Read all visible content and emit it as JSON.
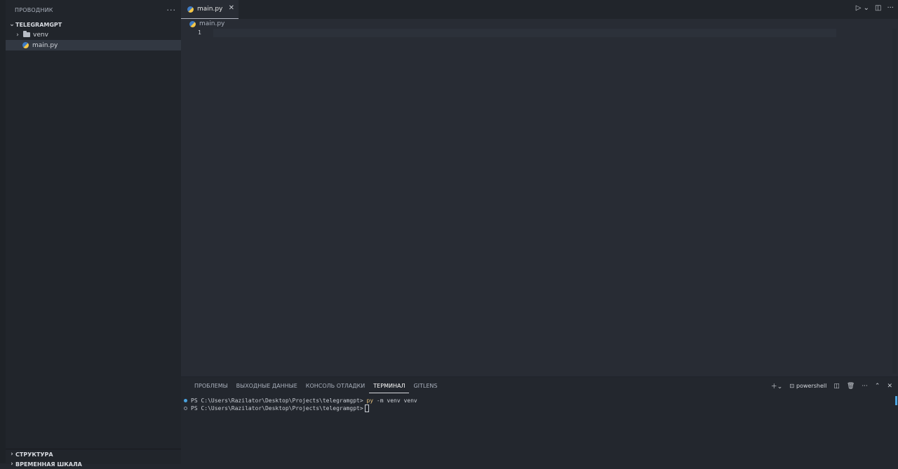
{
  "sidebar": {
    "title": "ПРОВОДНИК",
    "more_icon": "ellipsis-icon",
    "project": "TELEGRAMGPT",
    "items": [
      {
        "label": "venv",
        "icon": "folder-icon"
      },
      {
        "label": "main.py",
        "icon": "python-icon"
      }
    ],
    "bottom_sections": [
      "СТРУКТУРА",
      "ВРЕМЕННАЯ ШКАЛА"
    ]
  },
  "editor": {
    "tab_label": "main.py",
    "breadcrumb": "main.py",
    "line_number": "1"
  },
  "panel": {
    "tabs": [
      "ПРОБЛЕМЫ",
      "ВЫХОДНЫЕ ДАННЫЕ",
      "КОНСОЛЬ ОТЛАДКИ",
      "ТЕРМИНАЛ",
      "GITLENS"
    ],
    "active_tab": "ТЕРМИНАЛ",
    "shell": "powershell",
    "lines": [
      {
        "prompt": "PS C:\\Users\\Razilator\\Desktop\\Projects\\telegramgpt>",
        "command": "py",
        "args": " -m venv venv"
      },
      {
        "prompt": "PS C:\\Users\\Razilator\\Desktop\\Projects\\telegramgpt>",
        "command": "",
        "args": ""
      }
    ]
  },
  "colors": {
    "background": "#282c34",
    "sidebar": "#21252b",
    "accent": "#4aa3df",
    "command": "#e6c07b"
  }
}
